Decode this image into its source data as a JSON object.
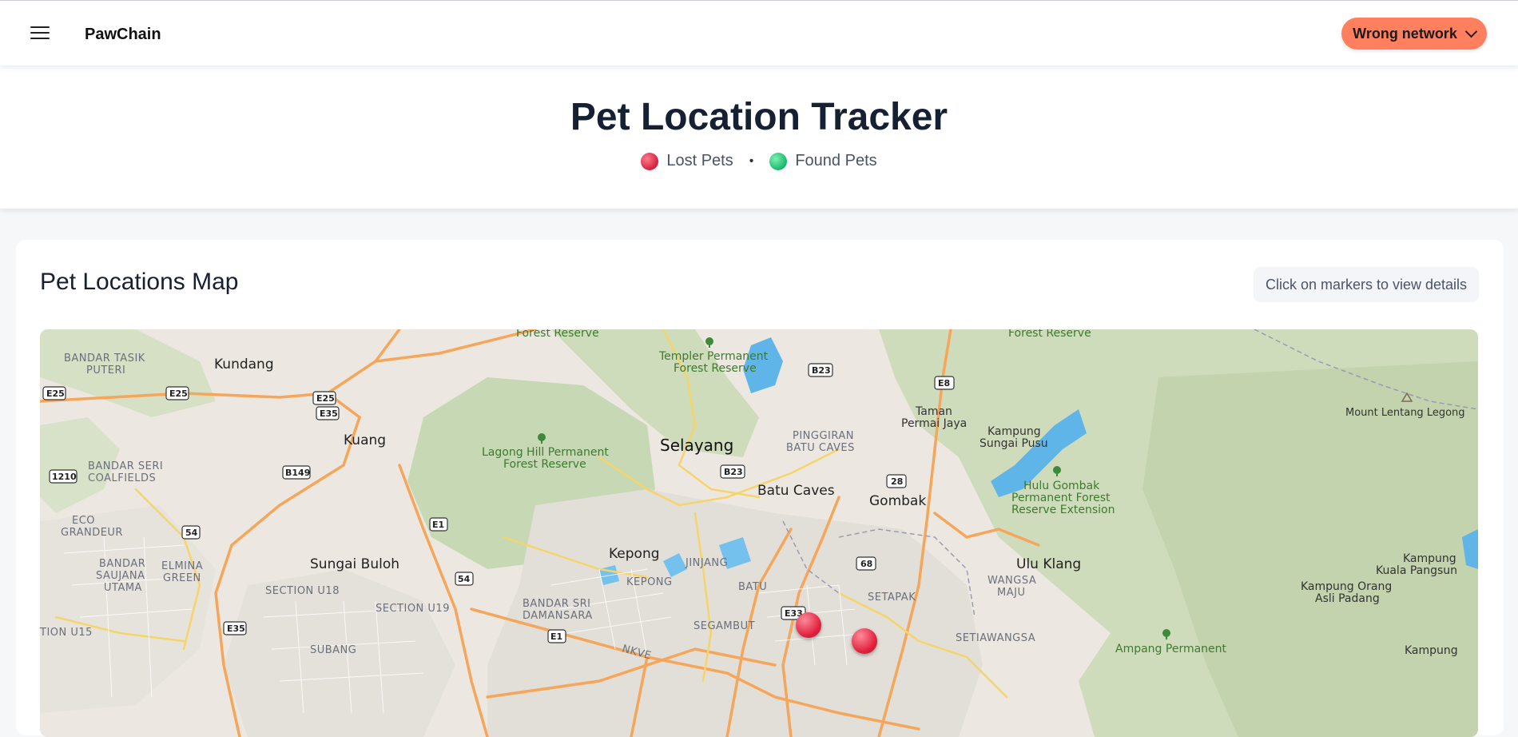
{
  "header": {
    "brand": "PawChain",
    "network_button": "Wrong network"
  },
  "hero": {
    "title": "Pet Location Tracker",
    "legend_lost": "Lost Pets",
    "legend_separator": "•",
    "legend_found": "Found Pets"
  },
  "map_card": {
    "title": "Pet Locations Map",
    "hint": "Click on markers to view details"
  },
  "map": {
    "places": {
      "selayang": "Selayang",
      "batu_caves": "Batu Caves",
      "gombak": "Gombak",
      "kepong": "Kepong",
      "sungai_buloh": "Sungai Buloh",
      "kuang": "Kuang",
      "kundang": "Kundang",
      "ulu_klang": "Ulu Klang",
      "taman_permai_jaya_1": "Taman",
      "taman_permai_jaya_2": "Permai Jaya",
      "kampung_sungai_pusu_1": "Kampung",
      "kampung_sungai_pusu_2": "Sungai Pusu",
      "bandar_tasik_puteri_1": "BANDAR TASIK",
      "bandar_tasik_puteri_2": "PUTERI",
      "bandar_seri_coalfields_1": "BANDAR SERI",
      "bandar_seri_coalfields_2": "COALFIELDS",
      "eco_grandeur_1": "ECO",
      "eco_grandeur_2": "GRANDEUR",
      "bandar_saujana_1": "BANDAR",
      "bandar_saujana_2": "SAUJANA",
      "bandar_saujana_3": "UTAMA",
      "elmina_1": "ELMINA",
      "elmina_2": "GREEN",
      "section_u18": "SECTION U18",
      "section_u19": "SECTION U19",
      "section_u15": "TION U15",
      "subang": "SUBANG",
      "pinggiran_1": "PINGGIRAN",
      "pinggiran_2": "BATU CAVES",
      "jinjang": "JINJANG",
      "kepong_small": "KEPONG",
      "batu": "BATU",
      "setapak": "SETAPAK",
      "wangsa_maju_1": "WANGSA",
      "wangsa_maju_2": "MAJU",
      "setiawangsa": "SETIAWANGSA",
      "bandar_sri_damansara_1": "BANDAR SRI",
      "bandar_sri_damansara_2": "DAMANSARA",
      "segambut": "SEGAMBUT",
      "kampung_kuala_pangsun_1": "Kampung",
      "kampung_kuala_pangsun_2": "Kuala Pangsun",
      "kampung_orang_asli_1": "Kampung Orang",
      "kampung_orang_asli_2": "Asli Padang",
      "kampung_bottom": "Kampung",
      "mount_lentang": "Mount Lentang Legong",
      "forest_reserve_left": "Forest Reserve",
      "forest_reserve_right": "Forest Reserve",
      "templer_1": "Templer Permanent",
      "templer_2": "Forest Reserve",
      "lagong_1": "Lagong Hill Permanent",
      "lagong_2": "Forest Reserve",
      "hulu_gombak_1": "Hulu Gombak",
      "hulu_gombak_2": "Permanent Forest",
      "hulu_gombak_3": "Reserve Extension",
      "ampang": "Ampang Permanent",
      "nkve": "NKVE"
    },
    "road_shields": [
      "E25",
      "E25",
      "E25",
      "E35",
      "1210",
      "B149",
      "54",
      "E1",
      "54",
      "E35",
      "E1",
      "B23",
      "B23",
      "E8",
      "28",
      "68",
      "E33"
    ],
    "markers": [
      {
        "type": "lost",
        "label": "Lost pet marker 1"
      },
      {
        "type": "lost",
        "label": "Lost pet marker 2"
      }
    ]
  },
  "colors": {
    "accent_button": "#ff7f5e",
    "lost": "#e0203d",
    "found": "#17b86a"
  }
}
